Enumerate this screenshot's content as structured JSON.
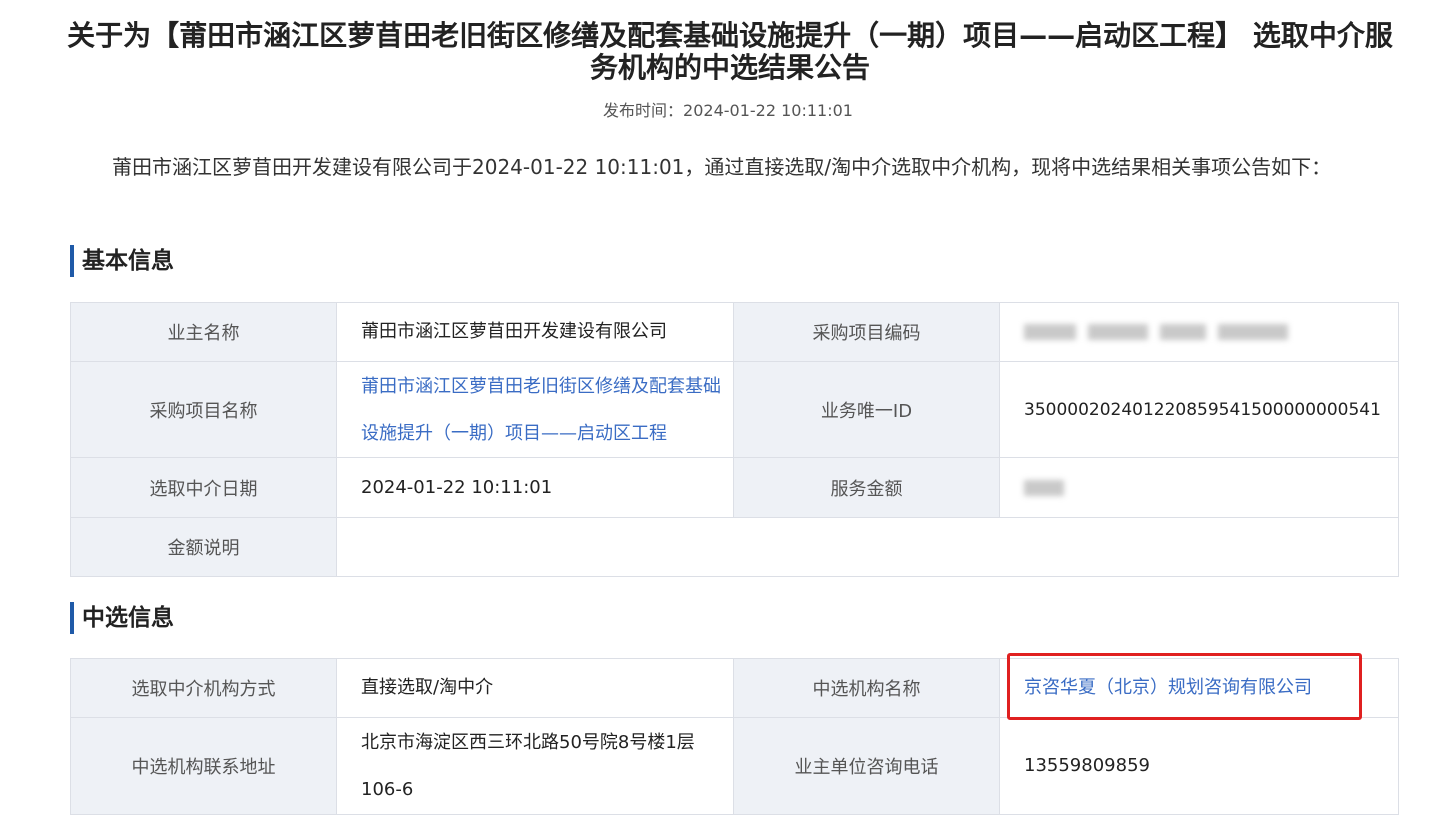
{
  "page": {
    "title": "关于为【莆田市涵江区萝苜田老旧街区修缮及配套基础设施提升（一期）项目——启动区工程】 选取中介服务机构的中选结果公告",
    "publish_time": "发布时间：2024-01-22 10:11:01",
    "intro": "莆田市涵江区萝苜田开发建设有限公司于2024-01-22 10:11:01，通过直接选取/淘中介选取中介机构，现将中选结果相关事项公告如下："
  },
  "basic": {
    "heading": "基本信息",
    "owner_label": "业主名称",
    "owner_value": "莆田市涵江区萝苜田开发建设有限公司",
    "code_label": "采购项目编码",
    "project_label": "采购项目名称",
    "project_value": "莆田市涵江区萝苜田老旧街区修缮及配套基础设施提升（一期）项目——启动区工程",
    "id_label": "业务唯一ID",
    "id_value": "350000202401220859541500000000541",
    "date_label": "选取中介日期",
    "date_value": "2024-01-22 10:11:01",
    "amount_label": "服务金额",
    "note_label": "金额说明",
    "note_value": ""
  },
  "selected": {
    "heading": "中选信息",
    "method_label": "选取中介机构方式",
    "method_value": "直接选取/淘中介",
    "org_label": "中选机构名称",
    "org_value": "京咨华夏（北京）规划咨询有限公司",
    "address_label": "中选机构联系地址",
    "address_value": "北京市海淀区西三环北路50号院8号楼1层106-6",
    "phone_label": "业主单位咨询电话",
    "phone_value": "13559809859"
  },
  "colors": {
    "accent": "#1f5aa8",
    "link": "#3a6cc4",
    "label_bg": "#eef1f6",
    "highlight": "#e02020"
  }
}
